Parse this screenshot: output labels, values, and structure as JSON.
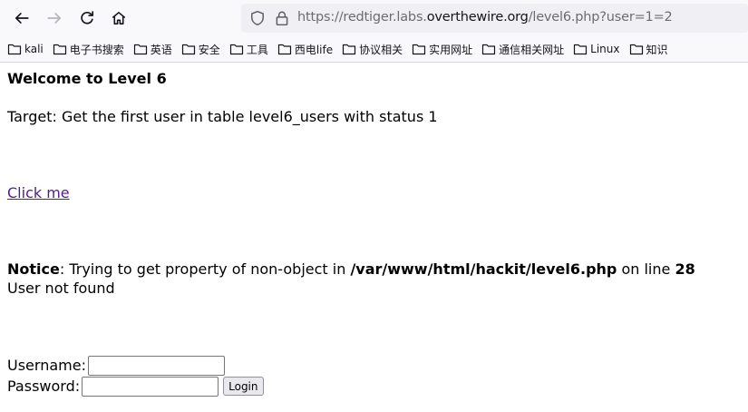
{
  "browser": {
    "url_prefix": "https://redtiger.labs.",
    "url_domain": "overthewire.org",
    "url_path": "/level6.php?user=1=2",
    "bookmarks": [
      "kali",
      "电子书搜索",
      "英语",
      "安全",
      "工具",
      "西电life",
      "协议相关",
      "实用网址",
      "通信相关网址",
      "Linux",
      "知识"
    ]
  },
  "page": {
    "heading": "Welcome to Level 6",
    "target": "Target: Get the first user in table level6_users with status 1",
    "link": "Click me",
    "notice_label": "Notice",
    "notice_text1": ": Trying to get property of non-object in ",
    "notice_path": "/var/www/html/hackit/level6.php",
    "notice_text2": " on line ",
    "notice_line": "28",
    "result": "User not found"
  },
  "form": {
    "username_label": "Username:",
    "username_value": "",
    "password_label": "Password:",
    "password_value": "",
    "login_label": "Login"
  }
}
